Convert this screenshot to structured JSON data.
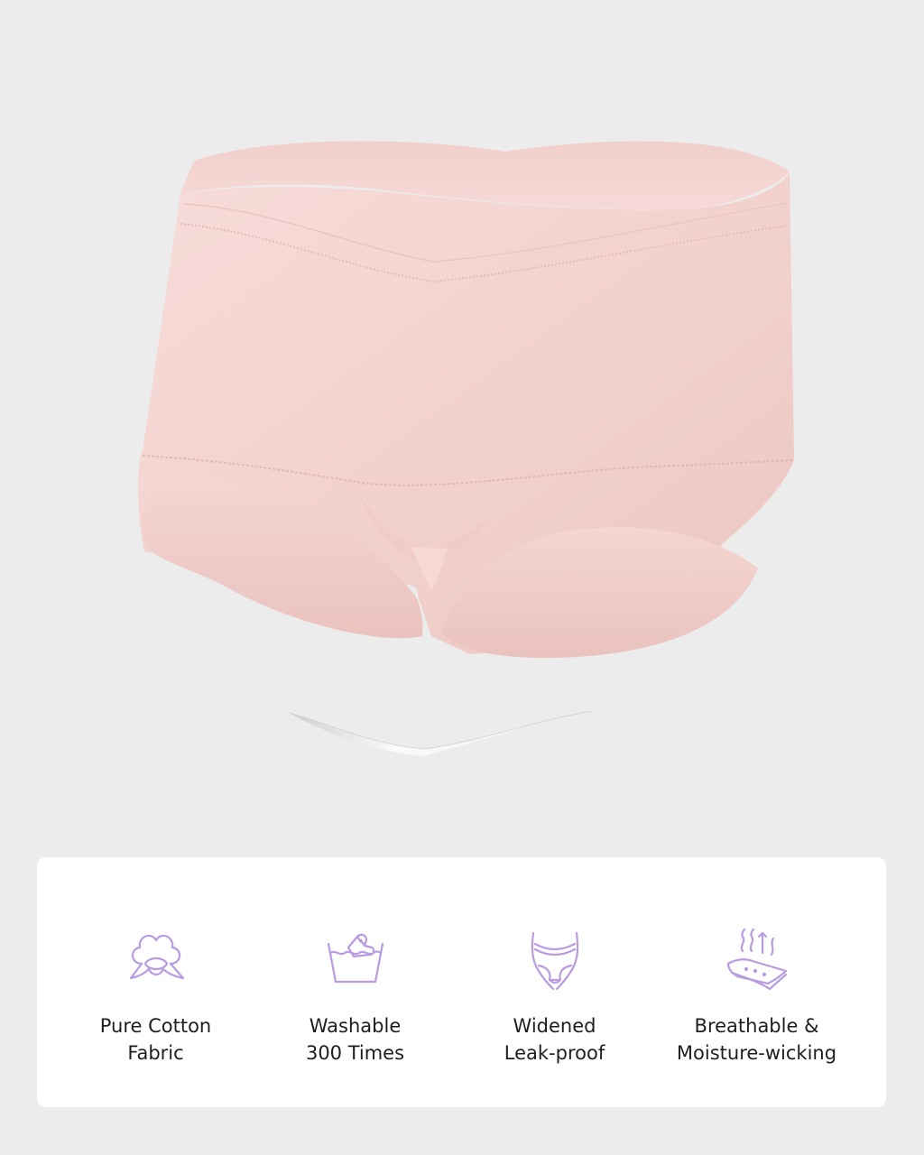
{
  "colors": {
    "background": "#ececec",
    "card": "#ffffff",
    "product_pink": "#f4d6d3",
    "icon_purple": "#b99be0",
    "text": "#1e1e1e"
  },
  "features": [
    {
      "icon": "cotton-icon",
      "line1": "Pure Cotton",
      "line2": "Fabric"
    },
    {
      "icon": "washable-icon",
      "line1": "Washable",
      "line2": "300 Times"
    },
    {
      "icon": "leak-proof-icon",
      "line1": "Widened",
      "line2": "Leak-proof"
    },
    {
      "icon": "breathable-icon",
      "line1": "Breathable &",
      "line2": "Moisture-wicking"
    }
  ]
}
